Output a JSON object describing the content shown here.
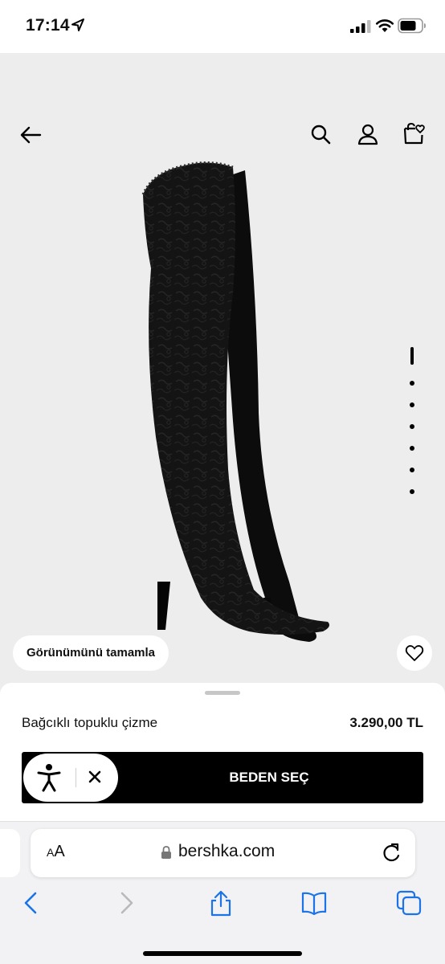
{
  "status_bar": {
    "time": "17:14",
    "icons": [
      "location-arrow-icon",
      "cellular-signal-icon",
      "wifi-icon",
      "battery-icon"
    ]
  },
  "header": {
    "icons": [
      "back-arrow-icon",
      "search-icon",
      "account-icon",
      "shopping-bag-heart-icon"
    ]
  },
  "gallery": {
    "image": "lace-over-the-knee-boot",
    "image_count": 7,
    "current_index": 1,
    "complete_look_label": "Görünümünü tamamla",
    "favorite_icon": "heart-icon",
    "background": "#ededed"
  },
  "product": {
    "name": "Bağcıklı topuklu çizme",
    "price": "3.290,00 TL",
    "size_button_label": "BEDEN SEÇ"
  },
  "accessibility_widget": {
    "icons": [
      "accessibility-person-icon",
      "close-icon"
    ]
  },
  "browser": {
    "aa_label_small": "A",
    "aa_label_large": "A",
    "url": "bershka.com",
    "toolbar_icons": [
      "back-chevron-icon",
      "forward-chevron-icon",
      "share-icon",
      "bookmarks-icon",
      "tabs-icon"
    ],
    "accent": "#1a73e8"
  }
}
